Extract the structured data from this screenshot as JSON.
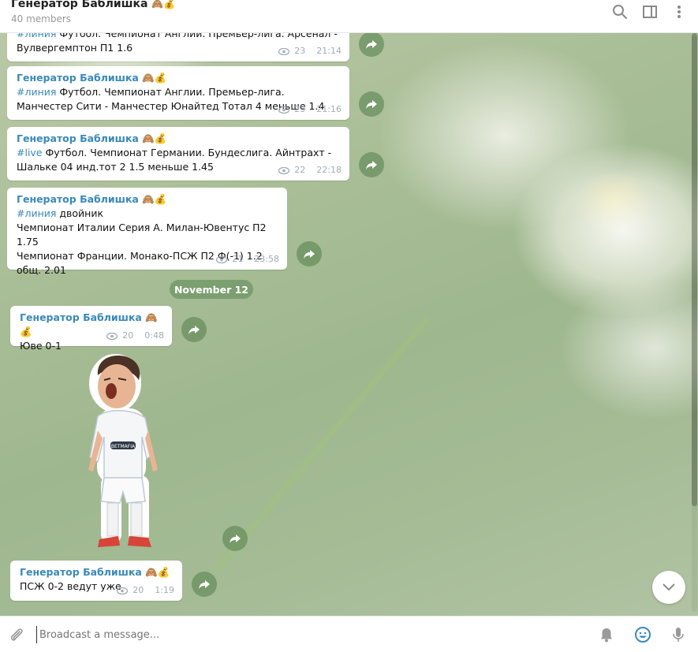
{
  "header": {
    "title": "Генератор Баблишка",
    "title_emoji": "🙈💰",
    "subtitle": "40 members"
  },
  "colors": {
    "accent": "#3a89b8",
    "share": "#6f9664",
    "date_pill": "#6e9664"
  },
  "messages": [
    {
      "author": "Генератор Баблишка 🙈💰",
      "hashtag": "#линия",
      "text": " Футбол. Чемпионат Англии. Премьер-лига. Арсенал - Вулвергемптон П1 1.6",
      "views": "23",
      "time": "21:14"
    },
    {
      "author": "Генератор Баблишка 🙈💰",
      "hashtag": "#линия",
      "text": " Футбол. Чемпионат Англии. Премьер-лига. Манчестер Сити - Манчестер Юнайтед Тотал 4 меньше 1.4",
      "views": "23",
      "time": "21:16"
    },
    {
      "author": "Генератор Баблишка 🙈💰",
      "hashtag": "#live",
      "text": " Футбол. Чемпионат Германии. Бундеслига. Айнтрахт - Шальке 04 инд.тот 2 1.5 меньше 1.45",
      "views": "22",
      "time": "22:18"
    },
    {
      "author": "Генератор Баблишка 🙈💰",
      "hashtag": "#линия",
      "line1": "  двойник",
      "line2": "Чемпионат Италии Серия А. Милан-Ювентус П2 1.75",
      "line3": "Чемпионат Франции. Монако-ПСЖ П2 Ф(-1) 1.2",
      "line4": "общ. 2.01",
      "views": "21",
      "time": "23:58"
    },
    {
      "author": "Генератор Баблишка 🙈💰",
      "text": "Юве 0-1",
      "views": "20",
      "time": "0:48"
    },
    {
      "author": "Генератор Баблишка 🙈💰",
      "text": "ПСЖ 0-2 ведут уже",
      "views": "20",
      "time": "1:19"
    }
  ],
  "date_separator": "November 12",
  "sticker": {
    "name": "football-player-sticker",
    "jersey_text": "BETMAFIA"
  },
  "composer": {
    "placeholder": "Broadcast a message..."
  }
}
